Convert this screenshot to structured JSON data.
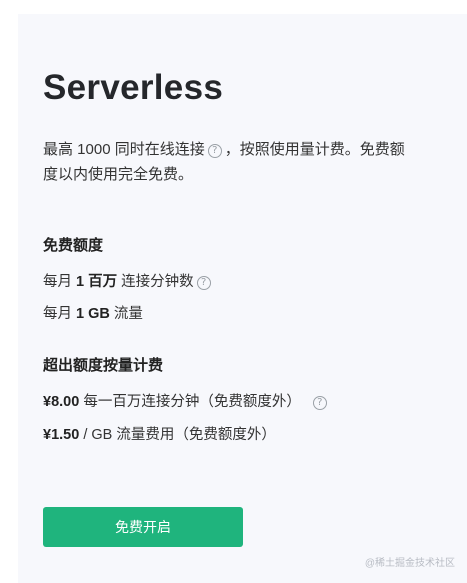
{
  "plan": {
    "title": "Serverless",
    "desc_line1_a": "最高 1000 同时在线连接",
    "desc_line1_b": "，按照使用量计费。免费额",
    "desc_line2": "度以内使用完全免费。",
    "help_glyph": "?"
  },
  "free_quota": {
    "title": "免费额度",
    "row1_prefix": "每月 ",
    "row1_value": "1 百万",
    "row1_suffix": " 连接分钟数",
    "row2_prefix": "每月 ",
    "row2_value": "1 GB",
    "row2_suffix": " 流量"
  },
  "overage": {
    "title": "超出额度按量计费",
    "row1_price": "¥8.00",
    "row1_text": " 每一百万连接分钟（免费额度外）",
    "row2_price": "¥1.50",
    "row2_text": " / GB 流量费用（免费额度外）"
  },
  "cta": {
    "label": "免费开启",
    "color": "#1fb47d"
  },
  "watermark": "@稀土掘金技术社区"
}
